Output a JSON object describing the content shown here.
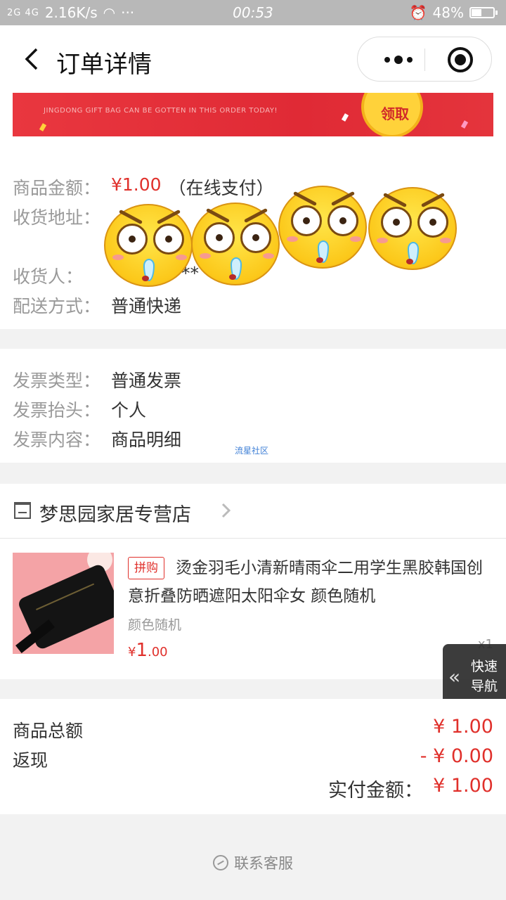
{
  "status_bar": {
    "signal": "2G 4G",
    "speed": "2.16K/s",
    "time": "00:53",
    "battery": "48%",
    "battery_level": 0.48
  },
  "header": {
    "title": "订单详情"
  },
  "banner": {
    "subtitle_en": "JINGDONG GIFT BAG CAN BE GOTTEN IN THIS ORDER TODAY!",
    "button": "领取"
  },
  "order": {
    "amount_label": "商品金额：",
    "amount_value": "¥1.00",
    "amount_note": "（在线支付）",
    "address_label": "收货地址：",
    "receiver_label": "收货人：",
    "receiver_value": "**",
    "shipping_label": "配送方式：",
    "shipping_value": "普通快递"
  },
  "invoice": {
    "type_label": "发票类型：",
    "type_value": "普通发票",
    "title_label": "发票抬头：",
    "title_value": "个人",
    "content_label": "发票内容：",
    "content_value": "商品明细",
    "watermark": "流星社区"
  },
  "shop": {
    "name": "梦思园家居专营店"
  },
  "product": {
    "tag": "拼购",
    "title": "烫金羽毛小清新晴雨伞二用学生黑胶韩国创意折叠防晒遮阳太阳伞女 颜色随机",
    "spec": "颜色随机",
    "price_symbol": "¥",
    "price_int": "1",
    "price_dec": ".00",
    "qty": "x1"
  },
  "quick_nav": {
    "line1": "快速",
    "line2": "导航"
  },
  "totals": {
    "goods_label": "商品总额",
    "goods_value": "¥ 1.00",
    "cashback_label": "返现",
    "cashback_value": "- ¥ 0.00",
    "paid_label": "实付金额：",
    "paid_value": "¥ 1.00"
  },
  "footer": {
    "service": "联系客服"
  }
}
